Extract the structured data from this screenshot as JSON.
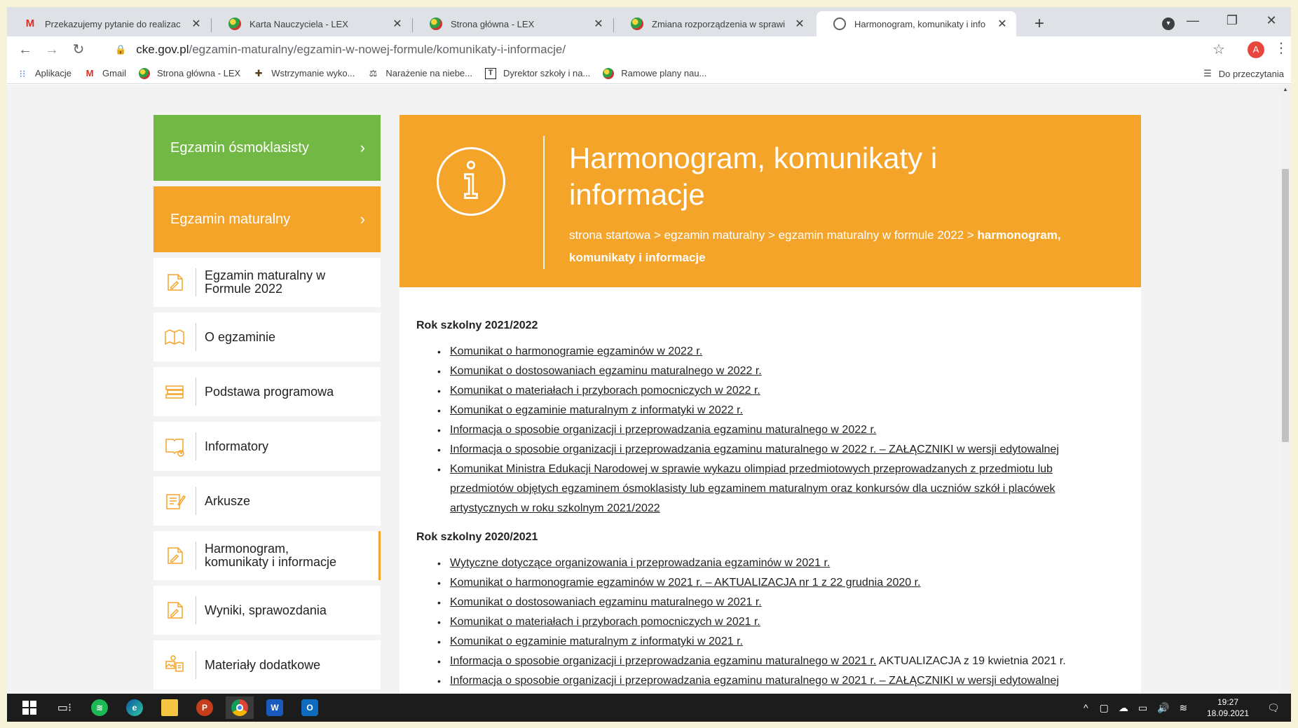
{
  "browser": {
    "tabs": [
      {
        "title": "Przekazujemy pytanie do realizac",
        "icon": "gmail-icon",
        "active": false
      },
      {
        "title": "Karta Nauczyciela - LEX",
        "icon": "lex-icon",
        "active": false
      },
      {
        "title": "Strona główna - LEX",
        "icon": "lex-icon",
        "active": false
      },
      {
        "title": "Zmiana rozporządzenia w sprawi",
        "icon": "lex-icon",
        "active": false
      },
      {
        "title": "Harmonogram, komunikaty i info",
        "icon": "globe-icon",
        "active": true
      }
    ],
    "new_tab": "+",
    "url_host": "cke.gov.pl",
    "url_path": "/egzamin-maturalny/egzamin-w-nowej-formule/komunikaty-i-informacje/",
    "profile_initial": "A",
    "bookmarks": [
      {
        "label": "Aplikacje",
        "icon": "apps-grid-icon"
      },
      {
        "label": "Gmail",
        "icon": "gmail-icon"
      },
      {
        "label": "Strona główna - LEX",
        "icon": "lex-icon"
      },
      {
        "label": "Wstrzymanie wyko...",
        "icon": "cross-icon"
      },
      {
        "label": "Narażenie na niebe...",
        "icon": "scales-icon"
      },
      {
        "label": "Dyrektor szkoły i na...",
        "icon": "t-box-icon"
      },
      {
        "label": "Ramowe plany nau...",
        "icon": "lex-icon"
      }
    ],
    "reading_list": "Do przeczytania"
  },
  "sidebar": {
    "primary": [
      {
        "label": "Egzamin ósmoklasisty",
        "color": "#72b844"
      },
      {
        "label": "Egzamin maturalny",
        "color": "#f5a42a"
      }
    ],
    "items": [
      {
        "label": "Egzamin maturalny w Formule 2022",
        "icon": "document-edit-icon",
        "active": false
      },
      {
        "label": "O egzaminie",
        "icon": "open-book-icon",
        "active": false
      },
      {
        "label": "Podstawa programowa",
        "icon": "books-stack-icon",
        "active": false
      },
      {
        "label": "Informatory",
        "icon": "book-clock-icon",
        "active": false
      },
      {
        "label": "Arkusze",
        "icon": "sheet-pen-icon",
        "active": false
      },
      {
        "label": "Harmonogram, komunikaty i informacje",
        "icon": "document-edit-icon",
        "active": true
      },
      {
        "label": "Wyniki, sprawozdania",
        "icon": "document-edit-icon",
        "active": false
      },
      {
        "label": "Materiały dodatkowe",
        "icon": "media-files-icon",
        "active": false
      }
    ]
  },
  "hero": {
    "title": "Harmonogram, komunikaty i informacje",
    "icon": "info-icon",
    "breadcrumb_plain": "strona startowa > egzamin maturalny > egzamin maturalny w formule 2022 > ",
    "breadcrumb_current": "harmonogram, komunikaty i informacje",
    "accent": "#f5a42a"
  },
  "sections": [
    {
      "heading": "Rok szkolny 2021/2022",
      "links": [
        {
          "text": "Komunikat o harmonogramie egzaminów w 2022 r.",
          "suffix": ""
        },
        {
          "text": "Komunikat o dostosowaniach egzaminu maturalnego w 2022 r.",
          "suffix": ""
        },
        {
          "text": "Komunikat o materiałach i przyborach pomocniczych w 2022 r.",
          "suffix": ""
        },
        {
          "text": "Komunikat o egzaminie maturalnym z informatyki w 2022 r.",
          "suffix": ""
        },
        {
          "text": "Informacja o sposobie organizacji i przeprowadzania egzaminu maturalnego w 2022 r.",
          "suffix": ""
        },
        {
          "text": "Informacja o sposobie organizacji i przeprowadzania egzaminu maturalnego w 2022 r. – ZAŁĄCZNIKI w wersji edytowalnej",
          "suffix": ""
        },
        {
          "text": "Komunikat Ministra Edukacji Narodowej w sprawie wykazu olimpiad przedmiotowych przeprowadzanych z przedmiotu lub przedmiotów objętych egzaminem ósmoklasisty lub egzaminem maturalnym oraz konkursów dla uczniów szkół i placówek artystycznych w roku szkolnym 2021/2022",
          "suffix": ""
        }
      ]
    },
    {
      "heading": "Rok szkolny 2020/2021",
      "links": [
        {
          "text": "Wytyczne dotyczące organizowania i przeprowadzania egzaminów w 2021 r.",
          "suffix": ""
        },
        {
          "text": "Komunikat o harmonogramie egzaminów w 2021 r. – AKTUALIZACJA nr 1 z 22 grudnia 2020 r.",
          "suffix": ""
        },
        {
          "text": "Komunikat o dostosowaniach egzaminu maturalnego w 2021 r.",
          "suffix": ""
        },
        {
          "text": "Komunikat o materiałach i przyborach pomocniczych w 2021 r.",
          "suffix": ""
        },
        {
          "text": "Komunikat o egzaminie maturalnym z informatyki w 2021 r.",
          "suffix": ""
        },
        {
          "text": "Informacja o sposobie organizacji i przeprowadzania egzaminu maturalnego w 2021 r.",
          "suffix": " AKTUALIZACJA z 19 kwietnia 2021 r."
        },
        {
          "text": "Informacja o sposobie organizacji i przeprowadzania egzaminu maturalnego w 2021 r. – ZAŁĄCZNIKI w wersji edytowalnej",
          "suffix": ""
        }
      ]
    }
  ],
  "taskbar": {
    "apps": [
      "windows-start-icon",
      "task-view-icon",
      "spotify-icon",
      "edge-icon",
      "file-explorer-icon",
      "powerpoint-icon",
      "chrome-icon",
      "word-icon",
      "outlook-icon"
    ],
    "time": "19:27",
    "date": "18.09.2021"
  }
}
